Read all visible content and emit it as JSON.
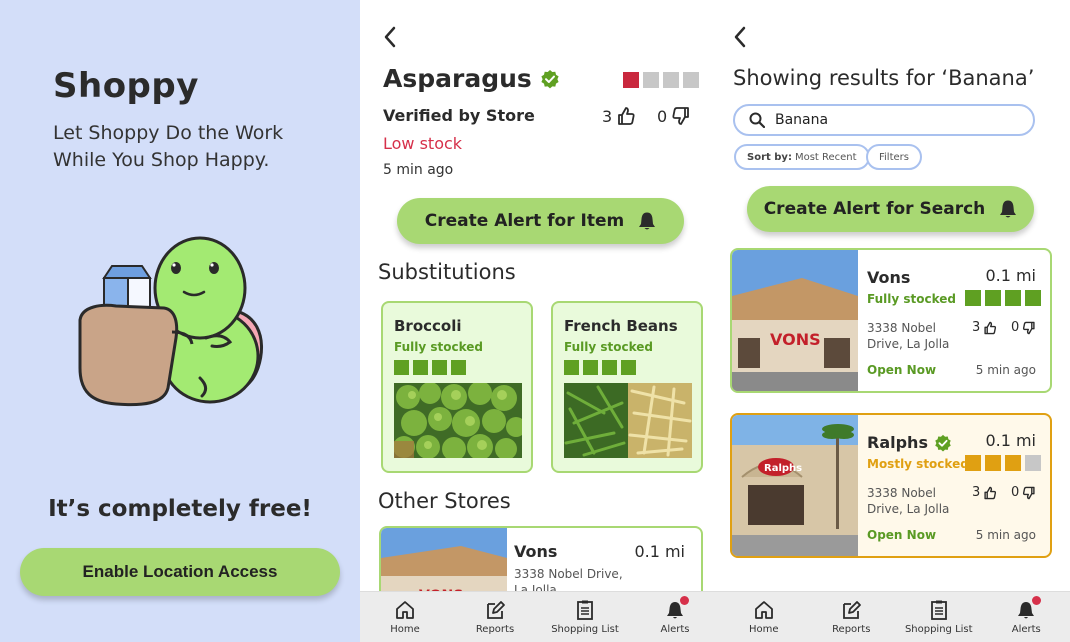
{
  "onboarding": {
    "app_name": "Shoppy",
    "tagline": "Let Shoppy Do the Work While You Shop Happy.",
    "free_text": "It’s completely free!",
    "location_button": "Enable Location Access"
  },
  "item": {
    "title": "Asparagus",
    "verified": "Verified by Store",
    "stock_status": "Low stock",
    "time_ago": "5 min ago",
    "upvotes": "3",
    "downvotes": "0",
    "stock_level": 1,
    "alert_button": "Create Alert for Item",
    "substitutions_heading": "Substitutions",
    "substitutions": [
      {
        "name": "Broccoli",
        "stock": "Fully stocked",
        "level": 4
      },
      {
        "name": "French Beans",
        "stock": "Fully stocked",
        "level": 4
      }
    ],
    "other_stores_heading": "Other Stores",
    "other_store": {
      "name": "Vons",
      "distance": "0.1 mi",
      "address": "3338 Nobel Drive, La Jolla"
    }
  },
  "search": {
    "title": "Showing results for ‘Banana’",
    "query": "Banana",
    "sort_label": "Sort by:",
    "sort_value": "Most Recent",
    "filters_label": "Filters",
    "alert_button": "Create Alert for Search",
    "results": [
      {
        "name": "Vons",
        "distance": "0.1 mi",
        "stock": "Fully stocked",
        "level": 4,
        "address_line1": "3338 Nobel",
        "address_line2": "Drive, La Jolla",
        "upvotes": "3",
        "downvotes": "0",
        "open": "Open Now",
        "time_ago": "5 min ago"
      },
      {
        "name": "Ralphs",
        "distance": "0.1 mi",
        "stock": "Mostly stocked",
        "level": 3,
        "address_line1": "3338 Nobel",
        "address_line2": "Drive, La Jolla",
        "upvotes": "3",
        "downvotes": "0",
        "open": "Open Now",
        "time_ago": "5 min ago"
      }
    ]
  },
  "tabbar": {
    "home": "Home",
    "reports": "Reports",
    "shopping_list": "Shopping List",
    "alerts": "Alerts"
  },
  "colors": {
    "accent_green": "#a8d873",
    "stock_green": "#5fa022",
    "stock_orange": "#e0a012",
    "stock_red": "#c9283e",
    "bar_gray": "#c7c7c7",
    "onboarding_bg": "#d3def9"
  }
}
